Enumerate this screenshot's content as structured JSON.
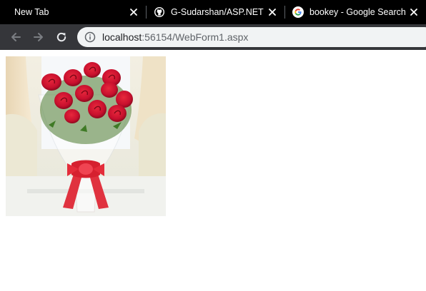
{
  "browser": {
    "tabs": [
      {
        "title": "New Tab",
        "favicon": "none",
        "active": true
      },
      {
        "title": "G-Sudarshan/ASP.NET",
        "favicon": "github-icon",
        "active": false
      },
      {
        "title": "bookey - Google Search",
        "favicon": "google-icon",
        "active": false
      }
    ],
    "toolbar": {
      "back_icon": "back-arrow-icon",
      "forward_icon": "forward-arrow-icon",
      "reload_icon": "reload-icon",
      "info_icon": "info-icon"
    },
    "address": {
      "host": "localhost",
      "path": ":56154/WebForm1.aspx"
    }
  },
  "page": {
    "image": {
      "subject": "red-rose-bouquet-image"
    }
  },
  "colors": {
    "tabstrip": "#000000",
    "toolbar": "#35363a",
    "omnibox": "#f1f3f4",
    "rose_red": "#c8102e"
  }
}
